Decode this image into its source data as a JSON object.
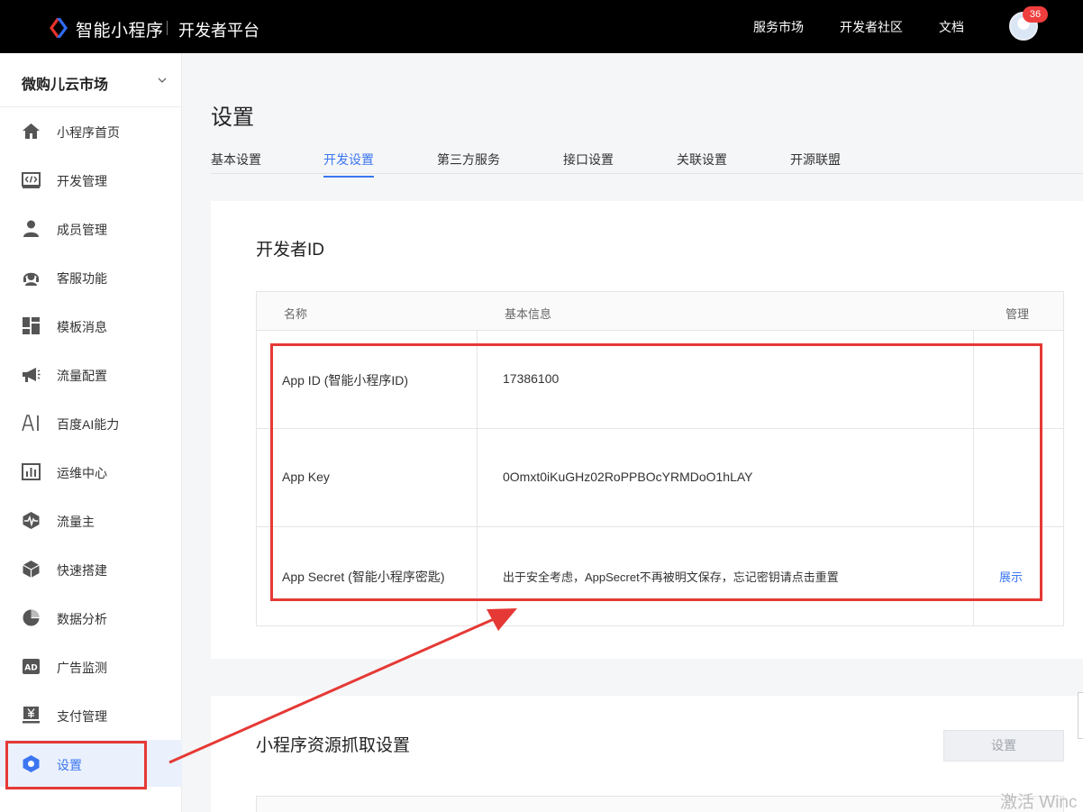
{
  "topbar": {
    "brand": "智能小程序",
    "platform": "开发者平台",
    "links": [
      "服务市场",
      "开发者社区",
      "文档"
    ],
    "notification_count": "36"
  },
  "sidebar": {
    "app_name": "微购儿云市场",
    "items": [
      {
        "label": "小程序首页",
        "icon": "home-icon"
      },
      {
        "label": "开发管理",
        "icon": "code-icon"
      },
      {
        "label": "成员管理",
        "icon": "user-icon"
      },
      {
        "label": "客服功能",
        "icon": "headset-icon"
      },
      {
        "label": "模板消息",
        "icon": "template-icon"
      },
      {
        "label": "流量配置",
        "icon": "megaphone-icon"
      },
      {
        "label": "百度AI能力",
        "icon": "ai-icon"
      },
      {
        "label": "运维中心",
        "icon": "bar-chart-icon"
      },
      {
        "label": "流量主",
        "icon": "pulse-icon"
      },
      {
        "label": "快速搭建",
        "icon": "cube-icon"
      },
      {
        "label": "数据分析",
        "icon": "pie-chart-icon"
      },
      {
        "label": "广告监测",
        "icon": "ad-icon"
      },
      {
        "label": "支付管理",
        "icon": "yuan-icon"
      },
      {
        "label": "设置",
        "icon": "settings-hex-icon",
        "active": true
      }
    ]
  },
  "main": {
    "title": "设置",
    "tabs": [
      {
        "label": "基本设置"
      },
      {
        "label": "开发设置",
        "active": true
      },
      {
        "label": "第三方服务"
      },
      {
        "label": "接口设置"
      },
      {
        "label": "关联设置"
      },
      {
        "label": "开源联盟"
      }
    ],
    "developer_id": {
      "title": "开发者ID",
      "headers": [
        "名称",
        "基本信息",
        "管理"
      ],
      "rows": [
        {
          "name": "App ID (智能小程序ID)",
          "info": "17386100",
          "action": ""
        },
        {
          "name": "App Key",
          "info": "0Omxt0iKuGHz02RoPPBOcYRMDoO1hLAY",
          "action": ""
        },
        {
          "name": "App Secret (智能小程序密匙)",
          "info": "出于安全考虑，AppSecret不再被明文保存，忘记密钥请点击重置",
          "action": "展示"
        }
      ]
    },
    "resource_fetch": {
      "title": "小程序资源抓取设置",
      "button": "设置"
    }
  },
  "watermark": "激活 Winc",
  "colors": {
    "accent": "#3c76f0",
    "annotation": "#e53935",
    "topbar": "#000000"
  }
}
